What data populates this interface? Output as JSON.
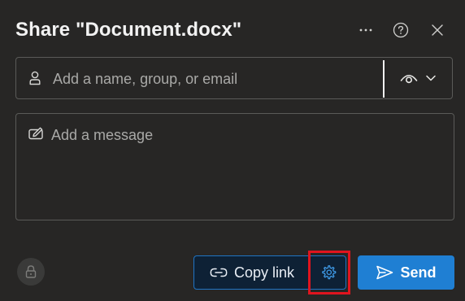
{
  "dialog": {
    "title": "Share \"Document.docx\""
  },
  "header": {
    "more_icon": "more-options-icon",
    "help_icon": "help-icon",
    "close_icon": "close-icon"
  },
  "recipients": {
    "placeholder": "Add a name, group, or email",
    "value": "",
    "icon": "person-icon",
    "permission_icon": "eye-icon",
    "permission_dropdown_icon": "chevron-down-icon"
  },
  "message": {
    "placeholder": "Add a message",
    "value": "",
    "icon": "pen-icon"
  },
  "footer": {
    "lock_icon": "lock-icon",
    "copy_link_label": "Copy link",
    "copy_link_icon": "link-icon",
    "settings_icon": "gear-icon",
    "send_label": "Send",
    "send_icon": "send-icon"
  },
  "colors": {
    "background": "#272625",
    "accent": "#1f7fd3",
    "highlight": "#e0141e"
  }
}
